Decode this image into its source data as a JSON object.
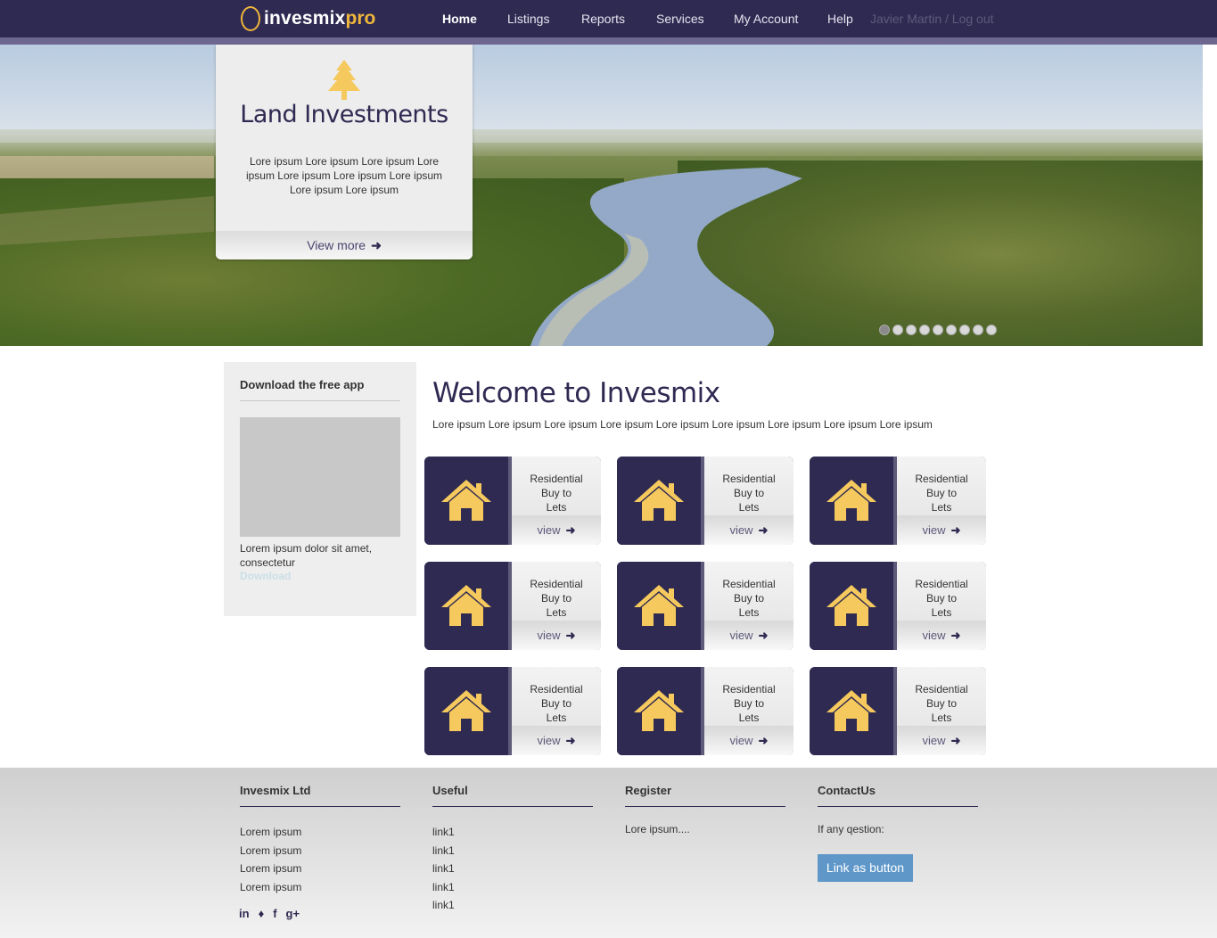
{
  "brand": {
    "name_a": "invesmix",
    "name_b": "pro"
  },
  "nav": {
    "items": [
      {
        "label": "Home",
        "active": true
      },
      {
        "label": "Listings"
      },
      {
        "label": "Reports"
      },
      {
        "label": "Services"
      },
      {
        "label": "My Account"
      },
      {
        "label": "Help"
      }
    ],
    "user": "Javier Martin / Log out"
  },
  "hero": {
    "title": "Land Investments",
    "text": "Lore ipsum Lore ipsum Lore ipsum Lore ipsum Lore ipsum Lore ipsum Lore ipsum Lore ipsum Lore ipsum",
    "more_label": "View more",
    "icon": "tree-icon",
    "slides": 9,
    "active_slide": 1
  },
  "sidebar": {
    "title": "Download the free app",
    "text": "Lorem ipsum dolor sit amet, consectetur",
    "link": "Download"
  },
  "main": {
    "title": "Welcome to Invesmix",
    "subtitle": "Lore ipsum Lore ipsum Lore ipsum Lore ipsum Lore ipsum Lore ipsum Lore ipsum Lore ipsum Lore ipsum",
    "tiles": [
      {
        "l1": "Residential",
        "l2": "Buy to",
        "l3": "Lets",
        "view": "view"
      },
      {
        "l1": "Residential",
        "l2": "Buy to",
        "l3": "Lets",
        "view": "view"
      },
      {
        "l1": "Residential",
        "l2": "Buy to",
        "l3": "Lets",
        "view": "view"
      },
      {
        "l1": "Residential",
        "l2": "Buy to",
        "l3": "Lets",
        "view": "view"
      },
      {
        "l1": "Residential",
        "l2": "Buy to",
        "l3": "Lets",
        "view": "view"
      },
      {
        "l1": "Residential",
        "l2": "Buy to",
        "l3": "Lets",
        "view": "view"
      },
      {
        "l1": "Residential",
        "l2": "Buy to",
        "l3": "Lets",
        "view": "view"
      },
      {
        "l1": "Residential",
        "l2": "Buy to",
        "l3": "Lets",
        "view": "view"
      },
      {
        "l1": "Residential",
        "l2": "Buy to",
        "l3": "Lets",
        "view": "view"
      }
    ]
  },
  "footer": {
    "col1": {
      "title": "Invesmix Ltd",
      "items": [
        "Lorem ipsum",
        "Lorem ipsum",
        "Lorem ipsum",
        "Lorem ipsum"
      ]
    },
    "col2": {
      "title": "Useful",
      "items": [
        "link1",
        "link1",
        "link1",
        "link1",
        "link1"
      ]
    },
    "col3": {
      "title": "Register",
      "text": "Lore ipsum...."
    },
    "col4": {
      "title": "ContactUs",
      "text": "If any qestion:",
      "button": "Link as button"
    },
    "social": [
      "in",
      "y",
      "f",
      "g+"
    ]
  },
  "colors": {
    "primary": "#2f2a52",
    "accent": "#f0b63b",
    "button": "#5f97c9"
  }
}
